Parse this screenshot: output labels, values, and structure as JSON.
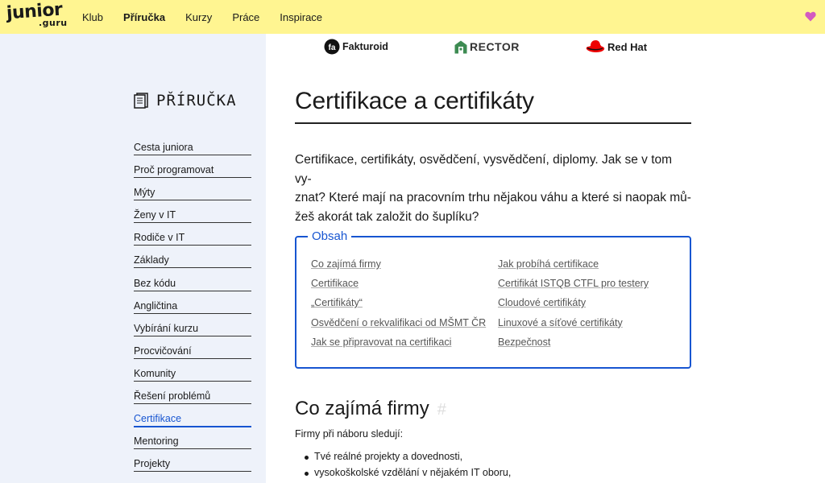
{
  "logo": {
    "line1": "junior",
    "line2": ".guru"
  },
  "nav": {
    "items": [
      {
        "label": "Klub",
        "active": false
      },
      {
        "label": "Příručka",
        "active": true
      },
      {
        "label": "Kurzy",
        "active": false
      },
      {
        "label": "Práce",
        "active": false
      },
      {
        "label": "Inspirace",
        "active": false
      }
    ]
  },
  "sponsors": {
    "fakturoid": "Fakturoid",
    "rector": "RECTOR",
    "redhat": "Red Hat"
  },
  "sidebar": {
    "title": "PŘÍRUČKA",
    "items": [
      "Cesta juniora",
      "Proč programovat",
      "Mýty",
      "Ženy v IT",
      "Rodiče v IT",
      "Základy",
      "Bez kódu",
      "Angličtina",
      "Vybírání kurzu",
      "Procvičování",
      "Komunity",
      "Řešení problémů",
      "Certifikace",
      "Mentoring",
      "Projekty"
    ],
    "active_index": 12
  },
  "article": {
    "title": "Certifikace a certifikáty",
    "lead_1": "Certifikace, certifikáty, osvědčení, vysvědčení, diplomy. Jak se v tom vy-",
    "lead_2": "znat? Které mají na pracovním trhu nějakou váhu a které si naopak mů-",
    "lead_3": "žeš akorát tak založit do šuplíku?",
    "toc_title": "Obsah",
    "toc_left": [
      "Co zajímá firmy",
      "Certifikace",
      "„Certifikáty“",
      "Osvědčení o rekvalifikaci od MŠMT ČR",
      "Jak se připravovat na certifikaci"
    ],
    "toc_right": [
      "Jak probíhá certifikace",
      "Certifikát ISTQB CTFL pro testery",
      "Cloudové certifikáty",
      "Linuxové a síťové certifikáty",
      "Bezpečnost"
    ],
    "section_title": "Co zajímá firmy",
    "section_hash": "#",
    "section_intro": "Firmy při náboru sledují:",
    "bullets": [
      "Tvé reálné projekty a dovednosti,",
      "vysokoškolské vzdělání v nějakém IT oboru,"
    ]
  },
  "colors": {
    "nav_bg": "#fff591",
    "sidebar_bg": "#eef2fa",
    "accent": "#1755d1",
    "heart": "#d35ac0"
  }
}
